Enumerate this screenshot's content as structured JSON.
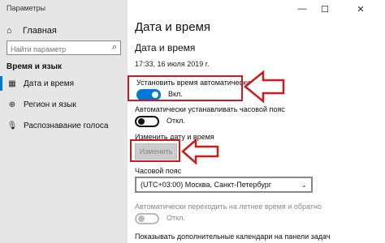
{
  "window": {
    "title": "Параметры",
    "minimize": "—",
    "maximize": "☐",
    "close": "✕"
  },
  "sidebar": {
    "home_label": "Главная",
    "search_placeholder": "Найти параметр",
    "section_title": "Время и язык",
    "items": [
      {
        "label": "Дата и время",
        "icon": "calendar-icon",
        "active": true
      },
      {
        "label": "Регион и язык",
        "icon": "region-icon",
        "active": false
      },
      {
        "label": "Распознавание голоса",
        "icon": "microphone-icon",
        "active": false
      }
    ]
  },
  "main": {
    "page_title": "Дата и время",
    "sub_title": "Дата и время",
    "datetime": "17:33, 16 июля 2019 г.",
    "auto_time": {
      "label": "Установить время автоматически",
      "state": "Вкл."
    },
    "auto_timezone": {
      "label": "Автоматически устанавливать часовой пояс",
      "state": "Откл."
    },
    "change_date": {
      "label": "Изменить дату и время",
      "button": "Изменить"
    },
    "timezone": {
      "label": "Часовой пояс",
      "value": "(UTC+03:00) Москва, Санкт-Петербург"
    },
    "dst": {
      "label": "Автоматически переходить на летнее время и обратно",
      "state": "Откл."
    },
    "extra_calendars": {
      "label": "Показывать дополнительные календари на панели задач"
    }
  },
  "colors": {
    "accent": "#0078d7",
    "callout": "#cc1b1b",
    "sidebar_bg": "#e6e6e6"
  }
}
